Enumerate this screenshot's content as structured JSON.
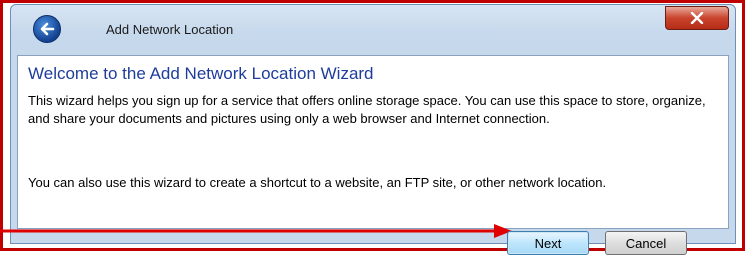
{
  "window": {
    "title": "Add Network Location",
    "back_icon": "back-arrow-icon",
    "close_icon": "close-x-icon"
  },
  "content": {
    "heading": "Welcome to the Add Network Location Wizard",
    "paragraph1": "This wizard helps you sign up for a service that offers online storage space.  You can use this space to store, organize, and share your documents and pictures using only a web browser and Internet connection.",
    "paragraph2": "You can also use this wizard to create a shortcut to a website, an FTP site, or other network location."
  },
  "buttons": {
    "next_label": "Next",
    "cancel_label": "Cancel"
  },
  "colors": {
    "highlight": "#c00000",
    "heading": "#1e3d9b"
  }
}
